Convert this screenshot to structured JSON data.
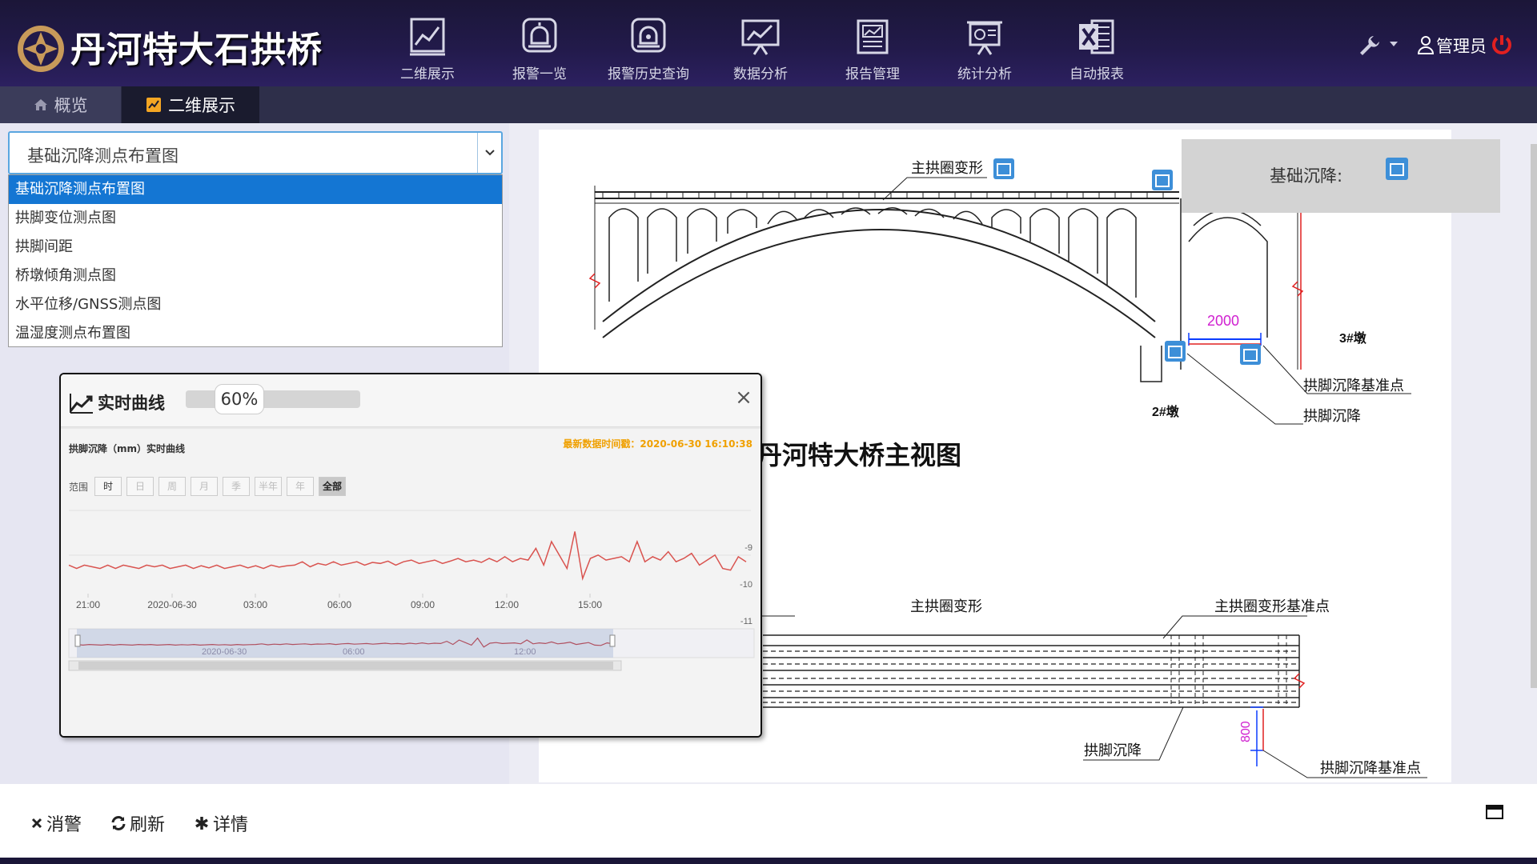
{
  "header": {
    "app_title": "丹河特大石拱桥",
    "nav": [
      {
        "label": "二维展示",
        "icon": "line-chart-icon"
      },
      {
        "label": "报警一览",
        "icon": "alarm-bell-icon"
      },
      {
        "label": "报警历史查询",
        "icon": "alarm-history-icon"
      },
      {
        "label": "数据分析",
        "icon": "analysis-chart-icon"
      },
      {
        "label": "报告管理",
        "icon": "report-icon"
      },
      {
        "label": "统计分析",
        "icon": "statistics-board-icon"
      },
      {
        "label": "自动报表",
        "icon": "excel-icon"
      }
    ],
    "user_name": "管理员"
  },
  "tabs": {
    "overview": "概览",
    "two_d": "二维展示"
  },
  "select": {
    "value": "基础沉降测点布置图",
    "options": [
      "基础沉降测点布置图",
      "拱脚变位测点图",
      "拱脚间距",
      "桥墩倾角测点图",
      "水平位移/GNSS测点图",
      "温湿度测点布置图"
    ]
  },
  "legend": {
    "label": "基础沉降:"
  },
  "drawing": {
    "labels": {
      "main_arch_deform_top": "主拱圈变形",
      "dim_2000": "2000",
      "pier3": "3#墩",
      "pier2": "2#墩",
      "arch_foot_ref_top": "拱脚沉降基准点",
      "arch_foot_settle_top": "拱脚沉降",
      "main_view_title": "丹河特大桥主视图",
      "main_arch_deform_bottom": "主拱圈变形",
      "main_arch_ref_bottom": "主拱圈变形基准点",
      "dim_800": "800",
      "arch_foot_settle_bottom": "拱脚沉降",
      "arch_foot_ref_bottom": "拱脚沉降基准点"
    }
  },
  "popup": {
    "title": "实时曲线",
    "progress_label": "60%",
    "progress_value": 0.6,
    "close": "×",
    "chart_title": "拱脚沉降（mm）实时曲线",
    "timestamp": "最新数据时间戳：2020-06-30 16:10:38",
    "range_label": "范围",
    "range_buttons": [
      "时",
      "日",
      "周",
      "月",
      "季",
      "半年",
      "年",
      "全部"
    ]
  },
  "chart_data": {
    "type": "line",
    "series": [
      {
        "values": [
          -10.2,
          -10.3,
          -10.2,
          -10.25,
          -10.3,
          -10.2,
          -10.3,
          -10.2,
          -10.25,
          -10.3,
          -10.2,
          -10.25,
          -10.2,
          -10.3,
          -10.25,
          -10.2,
          -10.3,
          -10.22,
          -10.28,
          -10.2,
          -10.3,
          -10.25,
          -10.2,
          -10.28,
          -10.22,
          -10.3,
          -10.2,
          -10.26,
          -10.22,
          -10.2,
          -10.1,
          -10.25,
          -10.15,
          -10.2,
          -10.1,
          -10.2,
          -10.15,
          -10.1,
          -10.2,
          -10.12,
          -10.15,
          -10.08,
          -10.2,
          -10.1,
          -10.05,
          -10.15,
          -10.1,
          -10.05,
          -10.15,
          -10.08,
          -10.0,
          -10.1,
          -10.05,
          -10.12,
          -10.0,
          -10.1,
          -9.95,
          -10.1,
          -10.0,
          -10.05,
          -9.7,
          -10.2,
          -9.5,
          -9.9,
          -10.3,
          -9.2,
          -10.6,
          -10.0,
          -9.9,
          -10.05,
          -10.0,
          -9.95,
          -10.1,
          -9.5,
          -10.1,
          -9.95,
          -10.05,
          -9.8,
          -10.1,
          -10.0,
          -9.85,
          -10.2,
          -10.05,
          -9.9,
          -10.3,
          -10.35,
          -9.95,
          -10.1
        ],
        "x_start_label": "2020-06-29 20:00",
        "x_end_label": "2020-06-30 16:10"
      }
    ],
    "x_tick_labels": [
      "21:00",
      "2020-06-30",
      "03:00",
      "06:00",
      "09:00",
      "12:00",
      "15:00"
    ],
    "y_tick_labels": [
      "-9",
      "-10",
      "-11"
    ],
    "ylim": [
      -11,
      -9
    ],
    "navigator_labels": [
      "2020-06-30",
      "06:00",
      "12:00"
    ]
  },
  "bottom_bar": {
    "dismiss_alarm": "消警",
    "refresh": "刷新",
    "details": "详情"
  },
  "colors": {
    "header_bg": "#221a4a",
    "accent_blue": "#1476d3",
    "series_red": "#d9534f",
    "power_red": "#e02020",
    "timestamp_orange": "#f0a000"
  }
}
